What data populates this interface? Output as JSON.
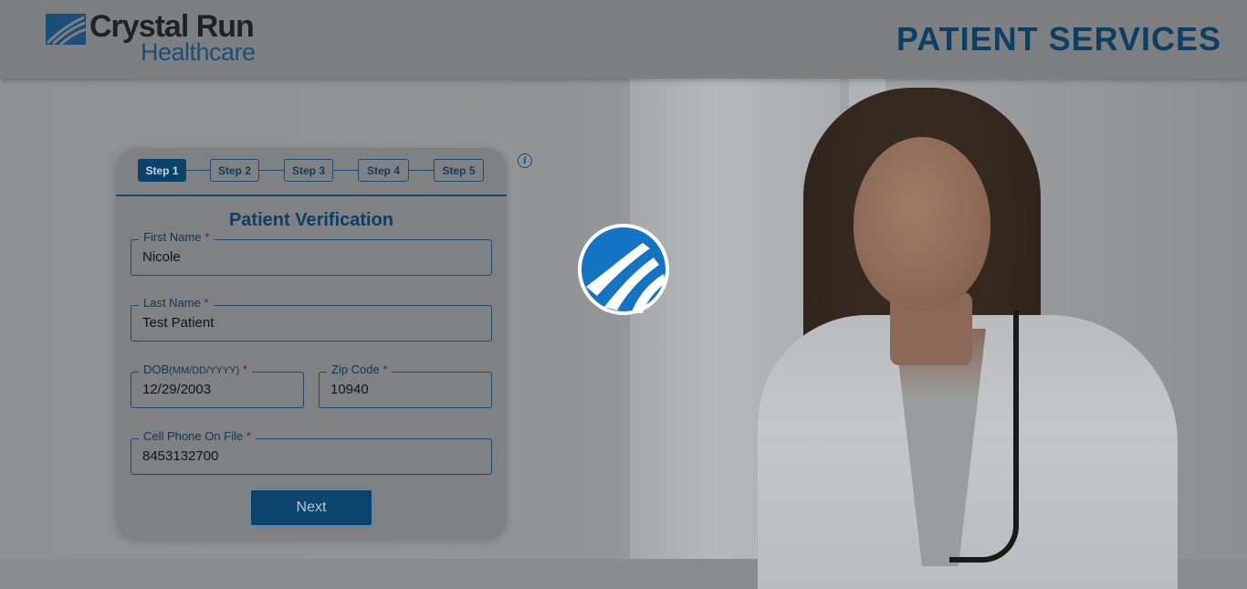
{
  "header": {
    "logo_title": "Crystal Run",
    "logo_sub": "Healthcare",
    "page_heading": "PATIENT SERVICES"
  },
  "steps": [
    {
      "label": "Step 1",
      "active": true
    },
    {
      "label": "Step 2",
      "active": false
    },
    {
      "label": "Step 3",
      "active": false
    },
    {
      "label": "Step 4",
      "active": false
    },
    {
      "label": "Step 5",
      "active": false
    }
  ],
  "info_icon": "i",
  "form": {
    "title": "Patient Verification",
    "first_name": {
      "label": "First Name",
      "required": "*",
      "value": "Nicole"
    },
    "last_name": {
      "label": "Last Name",
      "required": "*",
      "value": "Test Patient"
    },
    "dob": {
      "label": "DOB",
      "hint": "(MM/DD/YYYY)",
      "required": "*",
      "value": "12/29/2003"
    },
    "zip": {
      "label": "Zip Code",
      "required": "*",
      "value": "10940"
    },
    "phone": {
      "label": "Cell Phone On File",
      "required": "*",
      "value": "8453132700"
    },
    "next_label": "Next"
  },
  "colors": {
    "brand_blue": "#0a426c",
    "overlay": "#7f8183"
  }
}
